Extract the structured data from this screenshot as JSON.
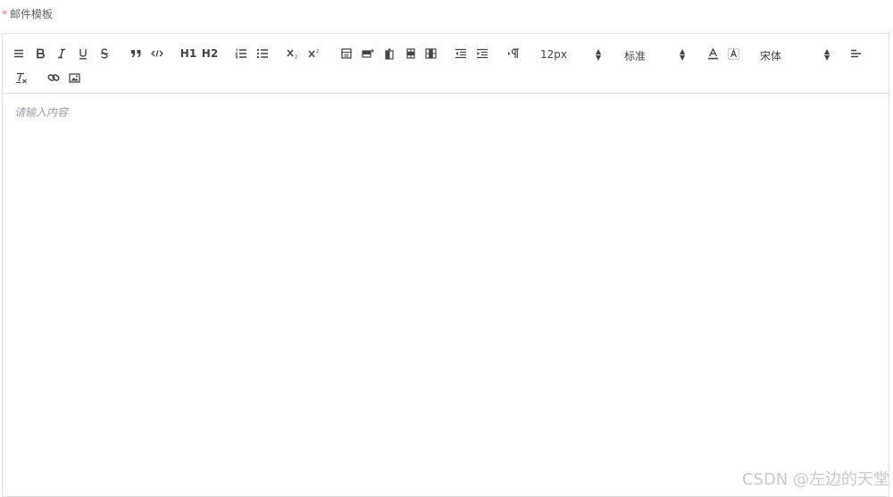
{
  "field": {
    "required_mark": "*",
    "label": "邮件模板"
  },
  "toolbar": {
    "header_text": {
      "h1": "H1",
      "h2": "H2"
    },
    "font_size": {
      "value": "12px"
    },
    "header_select": {
      "value": "标准"
    },
    "font_family": {
      "value": "宋体"
    },
    "icons": [
      "align-justify-icon",
      "bold-icon",
      "italic-icon",
      "underline-icon",
      "strike-icon",
      "blockquote-icon",
      "code-block-icon",
      "header1-icon",
      "header2-icon",
      "ordered-list-icon",
      "bullet-list-icon",
      "subscript-icon",
      "superscript-icon",
      "table-icon",
      "insert-row-icon",
      "insert-column-icon",
      "delete-row-icon",
      "delete-column-icon",
      "outdent-icon",
      "indent-icon",
      "rtl-icon",
      "font-color-icon",
      "background-color-icon",
      "align-icon",
      "clean-format-icon",
      "link-icon",
      "image-icon"
    ]
  },
  "editor": {
    "placeholder": "请输入内容"
  },
  "watermark": "CSDN @左边的天堂"
}
